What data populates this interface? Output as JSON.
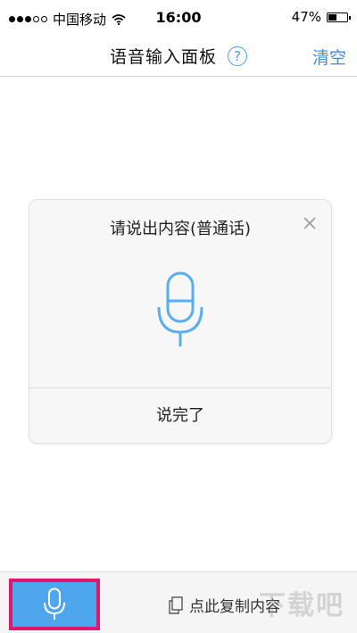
{
  "status_bar": {
    "carrier": "中国移动",
    "time": "16:00",
    "battery_percent": "47%",
    "battery_level": 0.47,
    "signal_strength": 3,
    "signal_max": 5,
    "wifi_icon": "wifi-icon"
  },
  "nav": {
    "title": "语音输入面板",
    "help_symbol": "?",
    "clear_label": "清空",
    "accent_color": "#3b8ee0"
  },
  "dialog": {
    "prompt": "请说出内容(普通话)",
    "close_icon": "close-icon",
    "mic_icon": "microphone-icon",
    "done_label": "说完了"
  },
  "bottom_bar": {
    "mic_icon": "microphone-icon",
    "mic_button_color": "#4ea6ec",
    "highlight_color": "#e3166a",
    "copy_icon": "copy-icon",
    "copy_label": "点此复制内容",
    "watermark": "下载吧"
  }
}
